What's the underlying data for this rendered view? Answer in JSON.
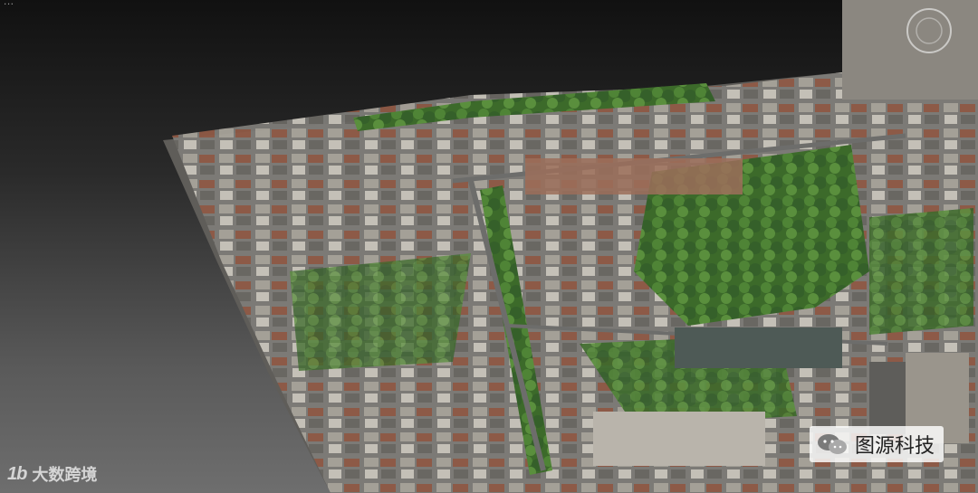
{
  "viewport": {
    "label": "..."
  },
  "watermarks": {
    "left_logo": "1b",
    "left_text": "大数跨境",
    "right_icon": "wechat-icon",
    "right_text": "图源科技"
  },
  "colors": {
    "background_top": "#111111",
    "background_bottom": "#6e6e6e",
    "tree": "#3f6e2c",
    "roof": "#8a8a88",
    "road": "#6d6d6b"
  }
}
